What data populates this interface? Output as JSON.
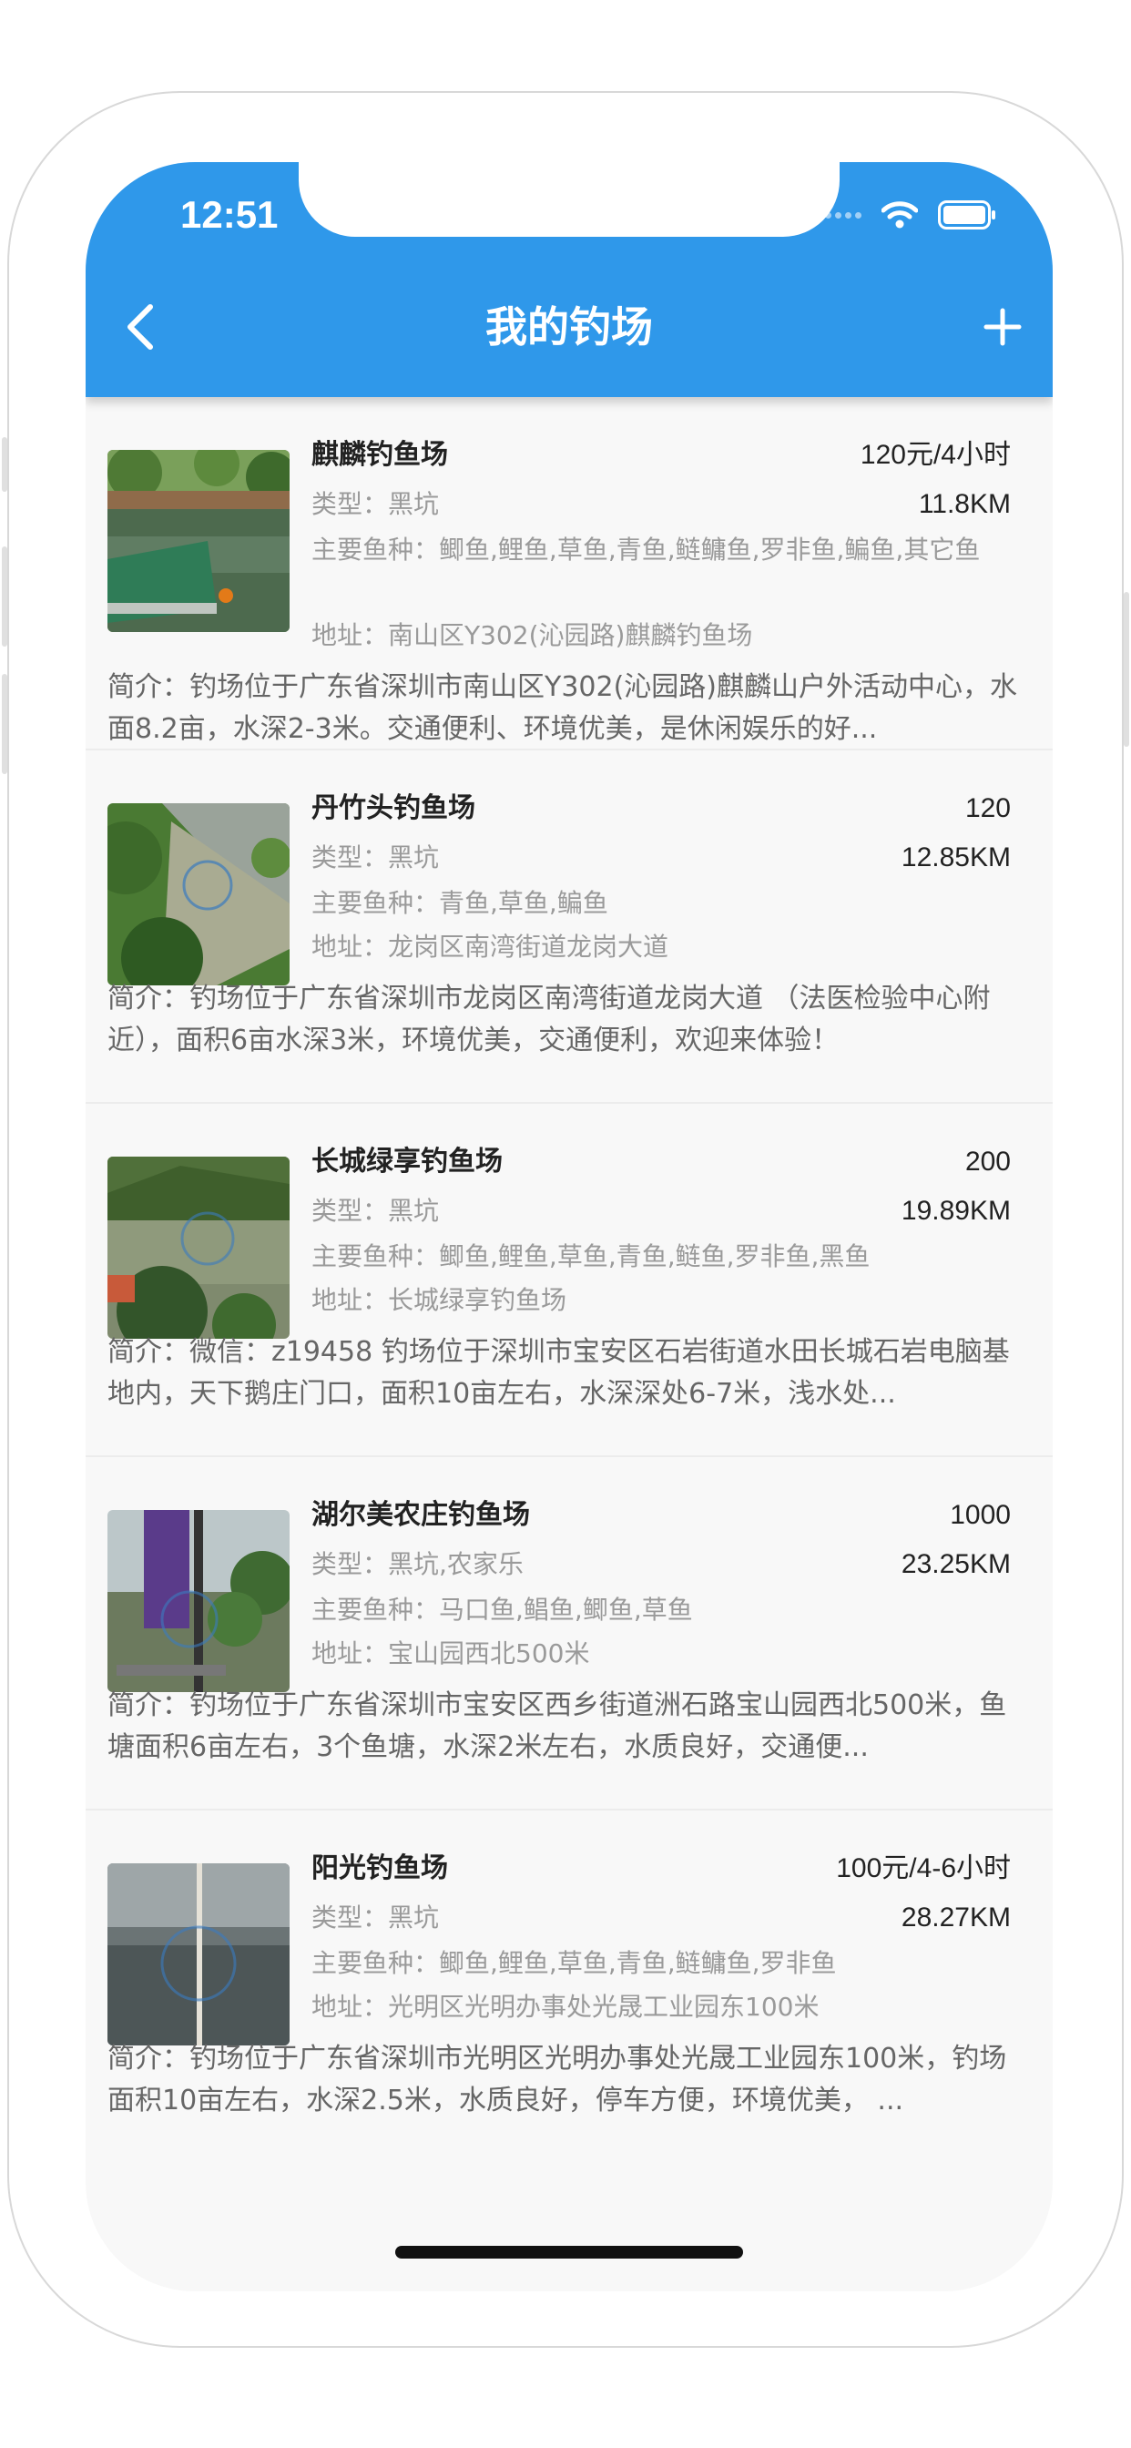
{
  "status_bar": {
    "time": "12:51"
  },
  "header": {
    "title": "我的钓场",
    "back_icon": "chevron-left-icon",
    "add_icon": "plus-icon"
  },
  "labels": {
    "type": "类型：",
    "species": "主要鱼种：",
    "address": "地址：",
    "intro": "简介："
  },
  "colors": {
    "accent": "#2f98ea",
    "title_text": "#222222",
    "muted_text": "#9a9a9a",
    "desc_text": "#666666"
  },
  "spots": [
    {
      "name": "麒麟钓鱼场",
      "price": "120元/4小时",
      "distance": "11.8KM",
      "type": "黑坑",
      "species": "鲫鱼,鲤鱼,草鱼,青鱼,鲢鳙鱼,罗非鱼,鳊鱼,其它鱼",
      "address": "南山区Y302(沁园路)麒麟钓鱼场",
      "description": "钓场位于广东省深圳市南山区Y302(沁园路)麒麟山户外活动中心，水面8.2亩，水深2-3米。交通便利、环境优美，是休闲娱乐的好..."
    },
    {
      "name": "丹竹头钓鱼场",
      "price": "120",
      "distance": "12.85KM",
      "type": "黑坑",
      "species": "青鱼,草鱼,鳊鱼",
      "address": "龙岗区南湾街道龙岗大道",
      "description": "钓场位于广东省深圳市龙岗区南湾街道龙岗大道 （法医检验中心附近），面积6亩水深3米，环境优美，交通便利，欢迎来体验！"
    },
    {
      "name": "长城绿享钓鱼场",
      "price": "200",
      "distance": "19.89KM",
      "type": "黑坑",
      "species": "鲫鱼,鲤鱼,草鱼,青鱼,鲢鱼,罗非鱼,黑鱼",
      "address": "长城绿享钓鱼场",
      "description": "微信：z19458 钓场位于深圳市宝安区石岩街道水田长城石岩电脑基地内，天下鹅庄门口，面积10亩左右，水深深处6-7米，浅水处..."
    },
    {
      "name": "湖尔美农庄钓鱼场",
      "price": "1000",
      "distance": "23.25KM",
      "type": "黑坑,农家乐",
      "species": "马口鱼,鲳鱼,鲫鱼,草鱼",
      "address": "宝山园西北500米",
      "description": "钓场位于广东省深圳市宝安区西乡街道洲石路宝山园西北500米，鱼塘面积6亩左右，3个鱼塘，水深2米左右，水质良好，交通便..."
    },
    {
      "name": "阳光钓鱼场",
      "price": "100元/4-6小时",
      "distance": "28.27KM",
      "type": "黑坑",
      "species": "鲫鱼,鲤鱼,草鱼,青鱼,鲢鳙鱼,罗非鱼",
      "address": "光明区光明办事处光晟工业园东100米",
      "description": "钓场位于广东省深圳市光明区光明办事处光晟工业园东100米，钓场面积10亩左右，水深2.5米，水质良好，停车方便，环境优美， ..."
    }
  ]
}
